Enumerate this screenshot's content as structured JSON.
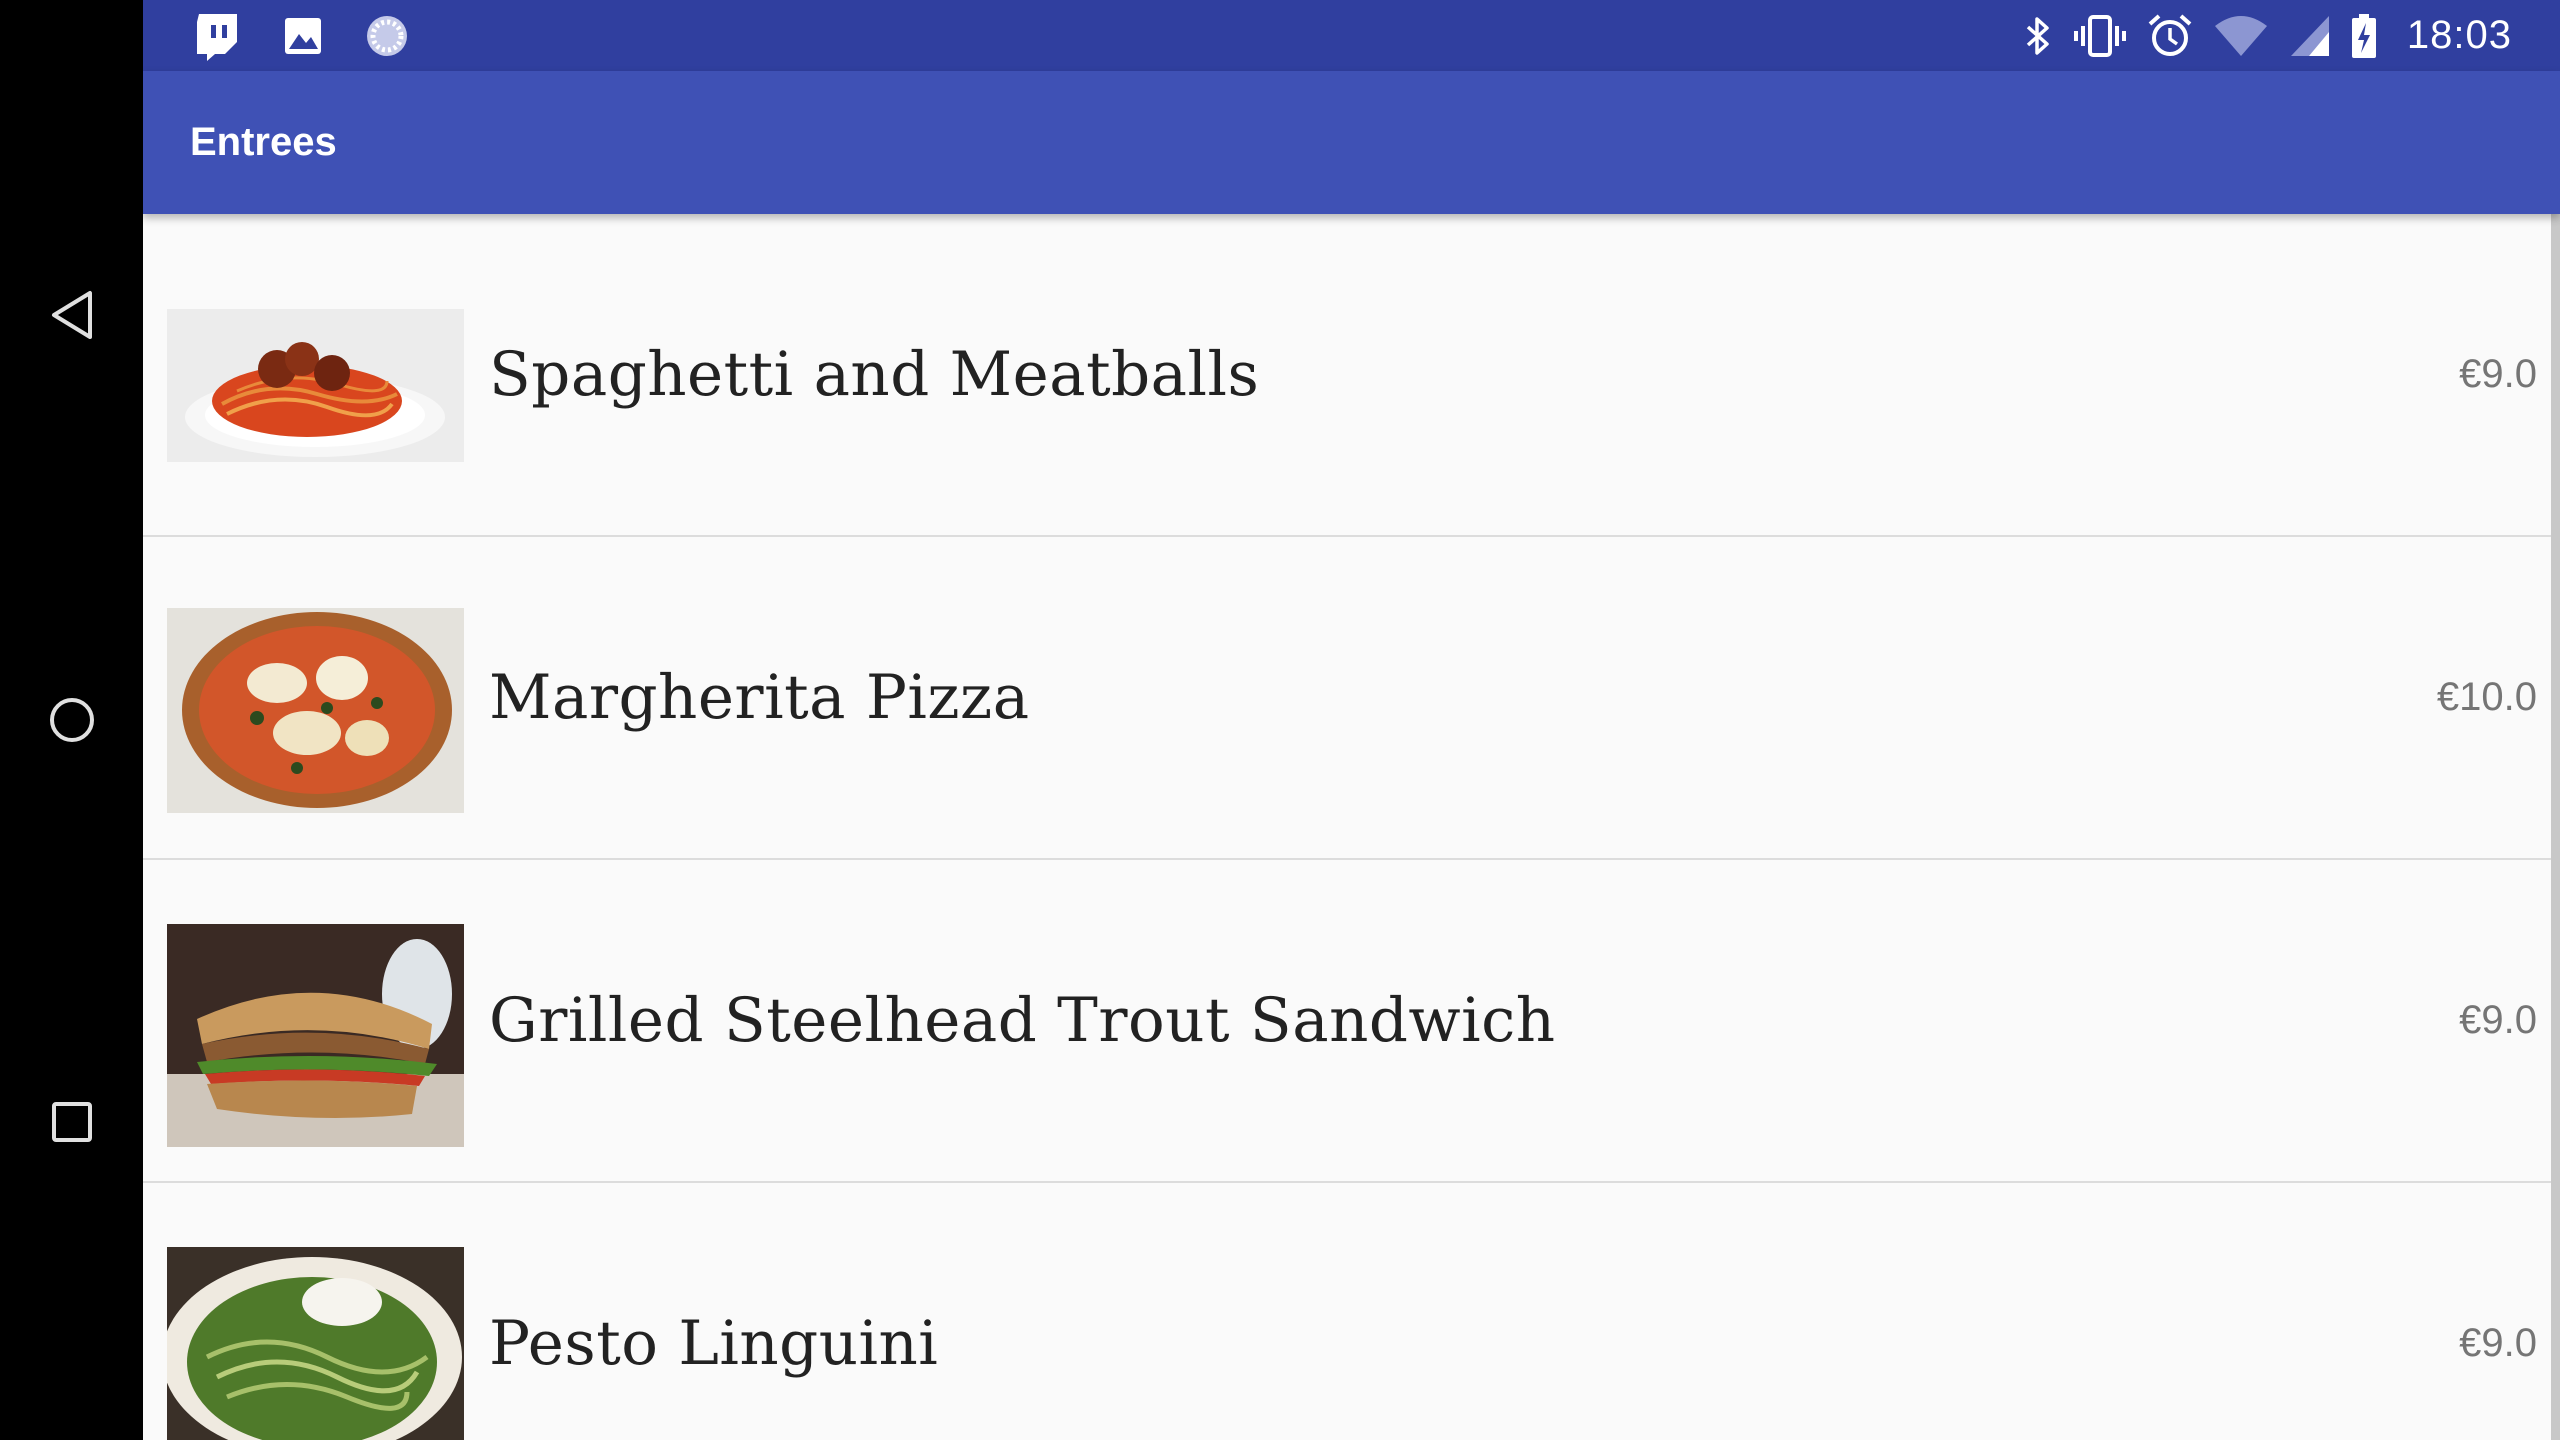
{
  "status_bar": {
    "time": "18:03",
    "left_icons": [
      "twitch-icon",
      "gallery-icon",
      "sync-icon"
    ],
    "right_icons": [
      "bluetooth-icon",
      "vibrate-icon",
      "alarm-icon",
      "wifi-icon",
      "cellular-signal-icon",
      "battery-charging-icon"
    ]
  },
  "app_bar": {
    "title": "Entrees"
  },
  "menu_items": [
    {
      "name": "Spaghetti and Meatballs",
      "price": "€9.0"
    },
    {
      "name": "Margherita Pizza",
      "price": "€10.0"
    },
    {
      "name": "Grilled Steelhead Trout Sandwich",
      "price": "€9.0"
    },
    {
      "name": "Pesto Linguini",
      "price": "€9.0"
    }
  ],
  "nav_bar": {
    "buttons": [
      "back-icon",
      "home-icon",
      "recents-icon"
    ]
  },
  "colors": {
    "status_bar": "#303f9f",
    "app_bar": "#3f51b5",
    "background": "#fafafa",
    "nav_bar": "#000000"
  }
}
